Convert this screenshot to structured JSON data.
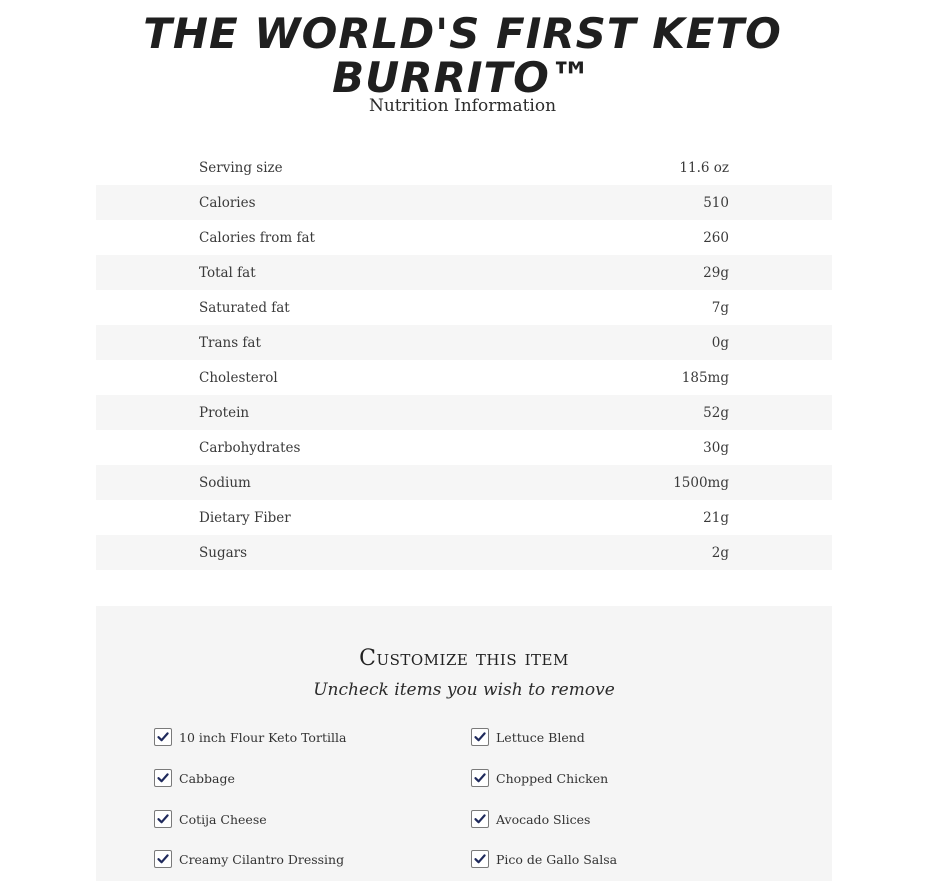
{
  "header": {
    "title_line1": "THE WORLD'S FIRST KETO",
    "title_line2": "BURRITO™",
    "subtitle": "Nutrition Information"
  },
  "nutrition": {
    "rows": [
      {
        "label": "Serving size",
        "value": "11.6 oz"
      },
      {
        "label": "Calories",
        "value": "510"
      },
      {
        "label": "Calories from fat",
        "value": "260"
      },
      {
        "label": "Total fat",
        "value": "29g"
      },
      {
        "label": "Saturated fat",
        "value": "7g"
      },
      {
        "label": "Trans fat",
        "value": "0g"
      },
      {
        "label": "Cholesterol",
        "value": "185mg"
      },
      {
        "label": "Protein",
        "value": "52g"
      },
      {
        "label": "Carbohydrates",
        "value": "30g"
      },
      {
        "label": "Sodium",
        "value": "1500mg"
      },
      {
        "label": "Dietary Fiber",
        "value": "21g"
      },
      {
        "label": "Sugars",
        "value": "2g"
      }
    ]
  },
  "customize": {
    "title": "Customize this item",
    "subtitle": "Uncheck items you wish to remove",
    "options": [
      {
        "label": "10 inch Flour Keto Tortilla",
        "checked": true
      },
      {
        "label": "Lettuce Blend",
        "checked": true
      },
      {
        "label": "Cabbage",
        "checked": true
      },
      {
        "label": "Chopped Chicken",
        "checked": true
      },
      {
        "label": "Cotija Cheese",
        "checked": true
      },
      {
        "label": "Avocado Slices",
        "checked": true
      },
      {
        "label": "Creamy Cilantro Dressing",
        "checked": true
      },
      {
        "label": "Pico de Gallo Salsa",
        "checked": true
      }
    ]
  },
  "colors": {
    "check": "#1f2a5c",
    "row_alt": "#f6f6f6",
    "panel": "#f5f5f5"
  },
  "icons": {
    "checkbox": "checkmark-icon"
  }
}
